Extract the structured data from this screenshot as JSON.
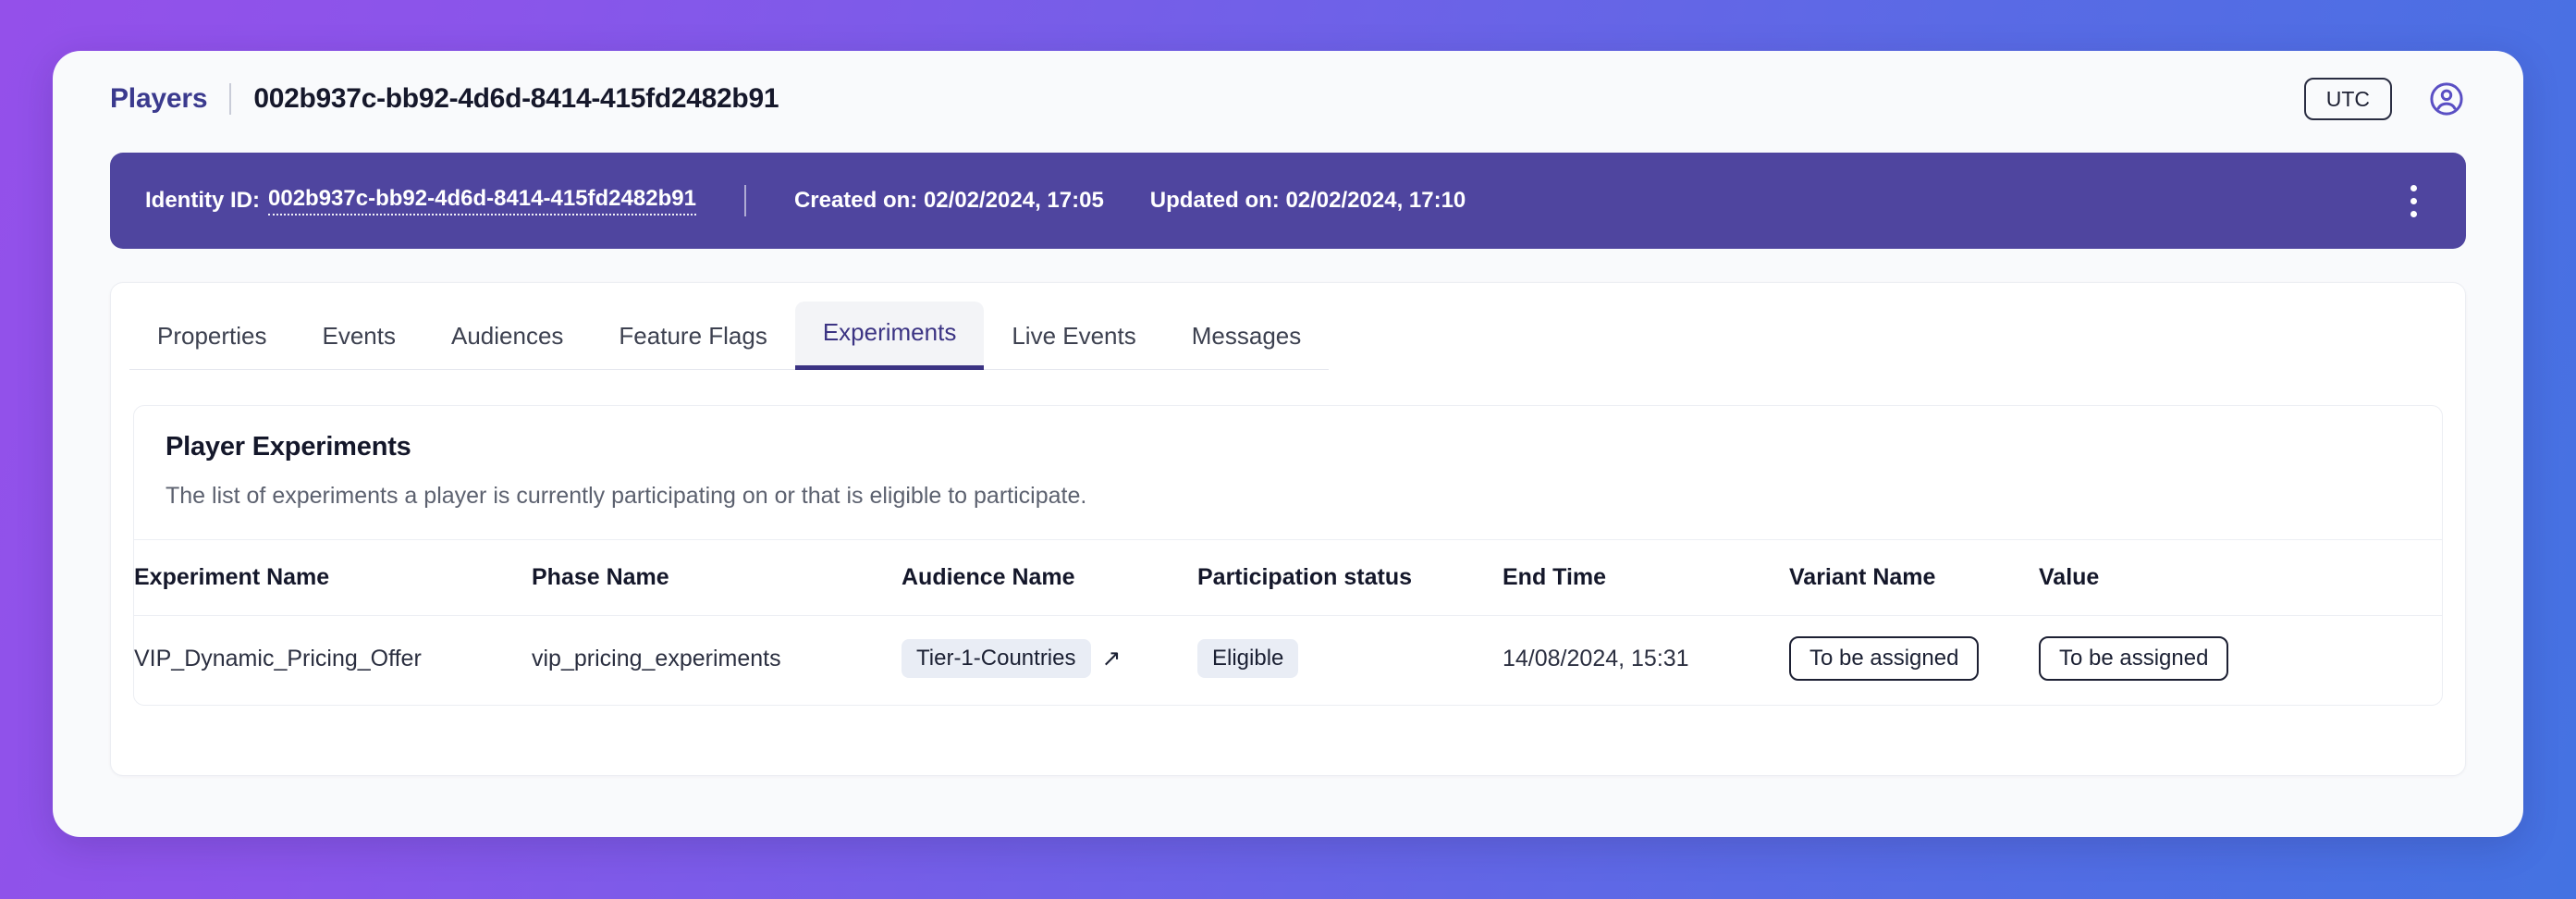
{
  "header": {
    "breadcrumb_root": "Players",
    "breadcrumb_separator": "|",
    "breadcrumb_current": "002b937c-bb92-4d6d-8414-415fd2482b91",
    "timezone_label": "UTC",
    "account_icon": "user-circle-icon"
  },
  "identity_banner": {
    "identity_label": "Identity ID:",
    "identity_value": "002b937c-bb92-4d6d-8414-415fd2482b91",
    "separator": "|",
    "created_on": "Created on: 02/02/2024, 17:05",
    "updated_on": "Updated on: 02/02/2024, 17:10",
    "menu_icon": "kebab-menu-icon",
    "background_color": "#4f459f"
  },
  "tabs": [
    {
      "label": "Properties",
      "active": false
    },
    {
      "label": "Events",
      "active": false
    },
    {
      "label": "Audiences",
      "active": false
    },
    {
      "label": "Feature Flags",
      "active": false
    },
    {
      "label": "Experiments",
      "active": true
    },
    {
      "label": "Live Events",
      "active": false
    },
    {
      "label": "Messages",
      "active": false
    }
  ],
  "experiments_section": {
    "title": "Player Experiments",
    "description": "The list of experiments a player is currently participating on or that is eligible to participate.",
    "columns": [
      "Experiment Name",
      "Phase Name",
      "Audience Name",
      "Participation status",
      "End Time",
      "Variant Name",
      "Value"
    ],
    "rows": [
      {
        "experiment_name": "VIP_Dynamic_Pricing_Offer",
        "phase_name": "vip_pricing_experiments",
        "audience_name": "Tier-1-Countries",
        "audience_link_icon": "external-link-arrow-icon",
        "participation_status": "Eligible",
        "end_time": "14/08/2024, 15:31",
        "variant_name": "To be assigned",
        "value": "To be assigned"
      }
    ]
  },
  "theme": {
    "accent_purple": "#3b3383",
    "banner_purple": "#4f459f",
    "chip_bg": "#e9edf5",
    "gradient_start": "#9450ea",
    "gradient_end": "#4472e2"
  }
}
